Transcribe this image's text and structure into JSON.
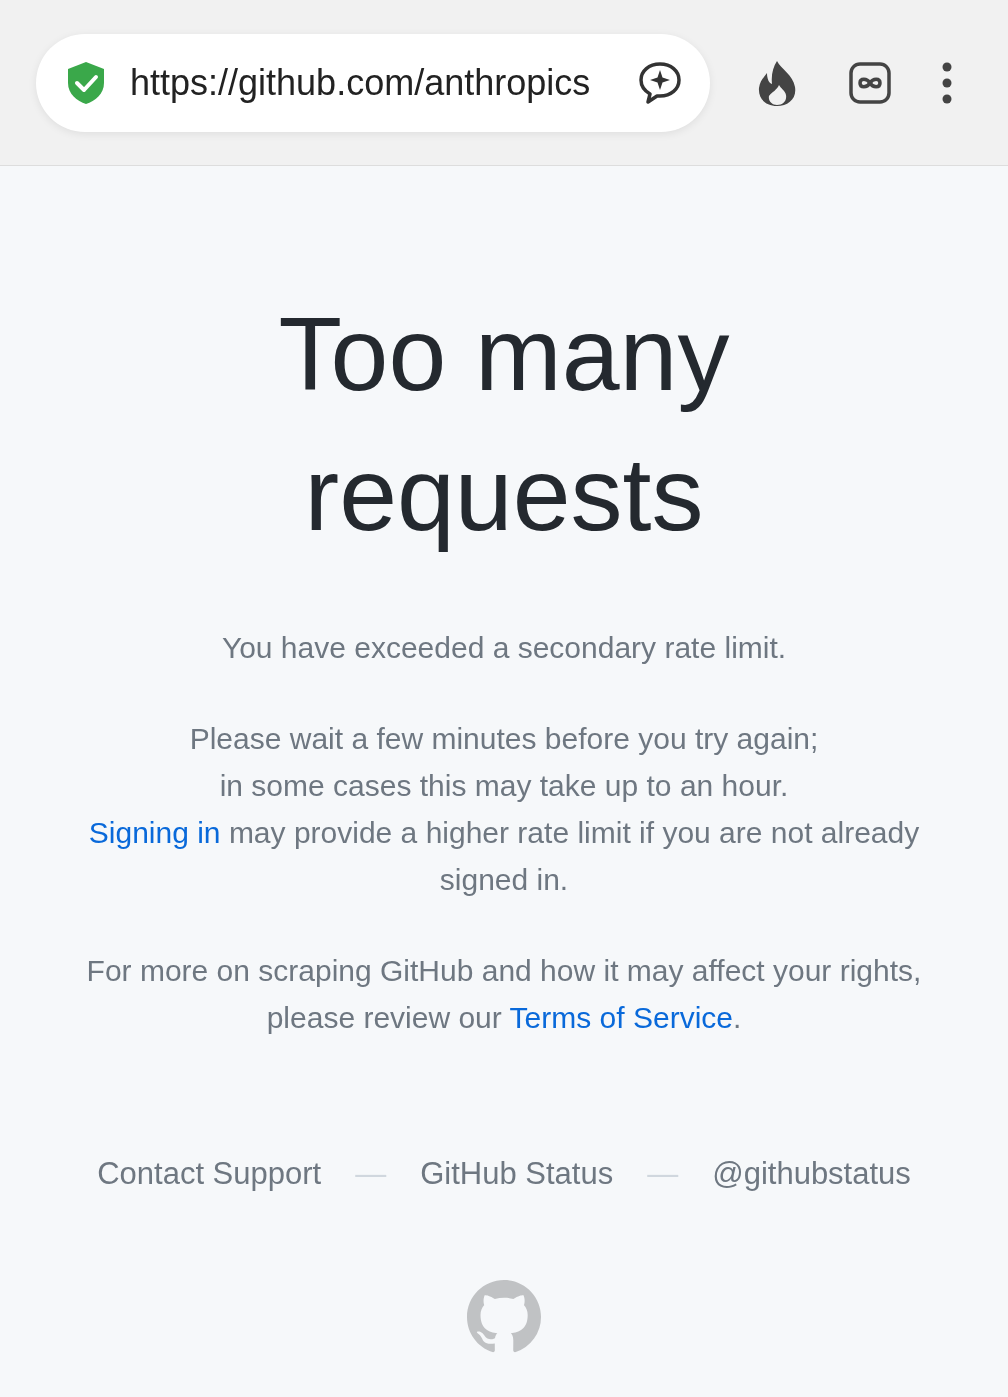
{
  "browser": {
    "url": "https://github.com/anthropics"
  },
  "heading": [
    "Too many",
    "requests"
  ],
  "paragraphs": [
    [
      {
        "kind": "text",
        "text": "You have exceeded a secondary rate limit."
      }
    ],
    [
      {
        "kind": "text",
        "text": "Please wait a few minutes before you try again;"
      },
      {
        "kind": "break"
      },
      {
        "kind": "text",
        "text": "in some cases this may take up to an hour."
      },
      {
        "kind": "break"
      },
      {
        "kind": "link",
        "text": "Signing in"
      },
      {
        "kind": "text",
        "text": " may provide a higher rate limit if you are not already signed in."
      }
    ],
    [
      {
        "kind": "text",
        "text": "For more on scraping GitHub and how it may affect your rights, please review our "
      },
      {
        "kind": "link",
        "text": "Terms of Service"
      },
      {
        "kind": "text",
        "text": "."
      }
    ]
  ],
  "footer": [
    {
      "kind": "link",
      "text": "Contact Support"
    },
    {
      "kind": "separator",
      "text": "—"
    },
    {
      "kind": "link",
      "text": "GitHub Status"
    },
    {
      "kind": "separator",
      "text": "—"
    },
    {
      "kind": "link",
      "text": "@githubstatus"
    }
  ]
}
